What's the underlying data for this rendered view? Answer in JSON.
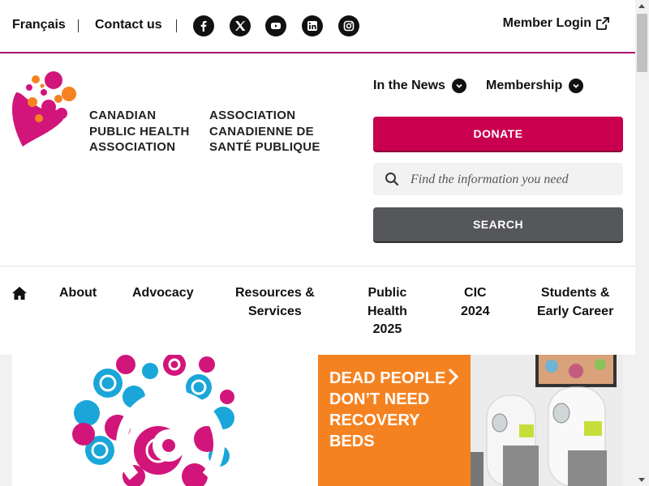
{
  "topbar": {
    "lang_link": "Français",
    "contact_link": "Contact us",
    "member_login": "Member Login",
    "social": [
      "facebook-icon",
      "x-icon",
      "youtube-icon",
      "linkedin-icon",
      "instagram-icon"
    ]
  },
  "header": {
    "org_name_en": [
      "CANADIAN",
      "PUBLIC HEALTH",
      "ASSOCIATION"
    ],
    "org_name_fr": [
      "ASSOCIATION",
      "CANADIENNE DE",
      "SANTÉ PUBLIQUE"
    ],
    "menu_news": "In the News",
    "menu_membership": "Membership",
    "donate_label": "DONATE",
    "search_placeholder": "Find the information you need",
    "search_label": "SEARCH"
  },
  "nav": {
    "items": [
      {
        "label": "About"
      },
      {
        "label": "Advocacy"
      },
      {
        "label": "Resources &\nServices"
      },
      {
        "label": "Public\nHealth\n2025"
      },
      {
        "label": "CIC\n2024"
      },
      {
        "label": "Students &\nEarly Career"
      }
    ]
  },
  "hero": {
    "card_text": "DEAD PEOPLE DON’T NEED RECOVERY BEDS"
  },
  "colors": {
    "brand_magenta": "#c8004f",
    "brand_orange": "#f58220",
    "divider": "#a8156a",
    "search_button": "#55575a"
  }
}
